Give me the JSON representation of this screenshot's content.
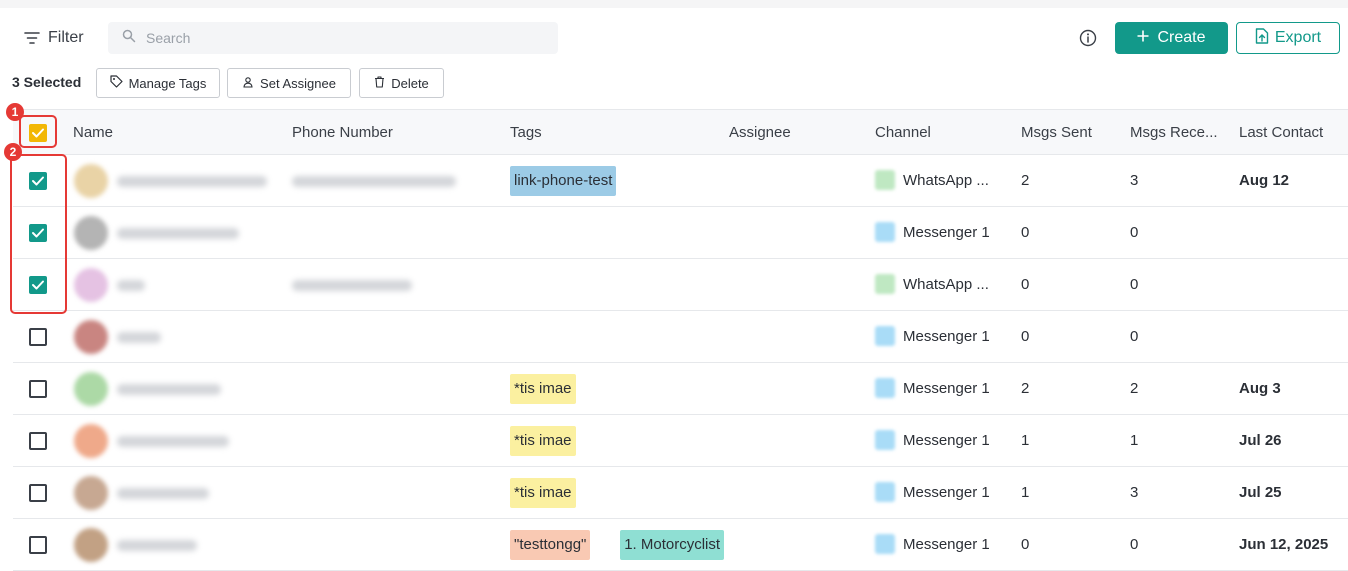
{
  "toolbar": {
    "filter_label": "Filter",
    "search_placeholder": "Search",
    "create_label": "Create",
    "export_label": "Export"
  },
  "selection": {
    "count_label": "3 Selected",
    "manage_tags": "Manage Tags",
    "set_assignee": "Set Assignee",
    "delete": "Delete"
  },
  "columns": [
    "Name",
    "Phone Number",
    "Tags",
    "Assignee",
    "Channel",
    "Msgs Sent",
    "Msgs Rece...",
    "Last Contact"
  ],
  "colors": {
    "accent": "#12998a",
    "annotation": "#e53935",
    "header_checkbox": "#f2b705"
  },
  "annotations": [
    "1",
    "2"
  ],
  "rows": [
    {
      "checked": true,
      "avatar_color": "#e9d3a6",
      "tags": [
        {
          "text": "link-phone-test",
          "color": "#9ccbe6"
        }
      ],
      "channel": "WhatsApp ...",
      "channel_icon": "#bfe8c2",
      "sent": "2",
      "received": "3",
      "last_contact": "Aug 12"
    },
    {
      "checked": true,
      "avatar_color": "#b4b4b4",
      "tags": [],
      "channel": "Messenger 1",
      "channel_icon": "#a9dcf7",
      "sent": "0",
      "received": "0",
      "last_contact": ""
    },
    {
      "checked": true,
      "avatar_color": "#e5c2e3",
      "tags": [],
      "channel": "WhatsApp ...",
      "channel_icon": "#bfe8c2",
      "sent": "0",
      "received": "0",
      "last_contact": ""
    },
    {
      "checked": false,
      "avatar_color": "#c98581",
      "tags": [],
      "channel": "Messenger 1",
      "channel_icon": "#a9dcf7",
      "sent": "0",
      "received": "0",
      "last_contact": ""
    },
    {
      "checked": false,
      "avatar_color": "#acd9a6",
      "tags": [
        {
          "text": "*tis imae",
          "color": "#fbf0a0"
        }
      ],
      "channel": "Messenger 1",
      "channel_icon": "#a9dcf7",
      "sent": "2",
      "received": "2",
      "last_contact": "Aug 3"
    },
    {
      "checked": false,
      "avatar_color": "#efa98a",
      "tags": [
        {
          "text": "*tis imae",
          "color": "#fbf0a0"
        }
      ],
      "channel": "Messenger 1",
      "channel_icon": "#a9dcf7",
      "sent": "1",
      "received": "1",
      "last_contact": "Jul 26"
    },
    {
      "checked": false,
      "avatar_color": "#c7a892",
      "tags": [
        {
          "text": "*tis imae",
          "color": "#fbf0a0"
        }
      ],
      "channel": "Messenger 1",
      "channel_icon": "#a9dcf7",
      "sent": "1",
      "received": "3",
      "last_contact": "Jul 25"
    },
    {
      "checked": false,
      "avatar_color": "#c2a184",
      "tags": [
        {
          "text": "\"testtongg\"",
          "color": "#f9c9b3"
        },
        {
          "text": "1. Motorcyclist",
          "color": "#8fdfd3"
        }
      ],
      "channel": "Messenger 1",
      "channel_icon": "#a9dcf7",
      "sent": "0",
      "received": "0",
      "last_contact": "Jun 12, 2025"
    }
  ]
}
